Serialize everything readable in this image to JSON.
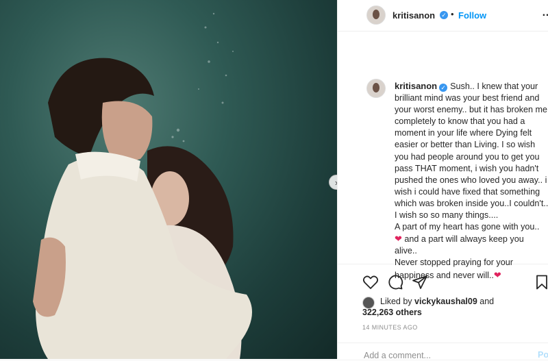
{
  "post": {
    "image_alt": "Underwater photo of a man in a white shirt embracing a woman with long dark hair",
    "next_glyph": "›"
  },
  "header": {
    "username": "kritisanon",
    "separator": "•",
    "follow_label": "Follow",
    "more_glyph": "…"
  },
  "caption": {
    "username": "kritisanon",
    "lines": [
      "Sush.. I knew that your brilliant mind was your best friend and your worst enemy.. but it has broken me completely to know that you had a moment in your life where Dying felt easier or better than Living. I so wish you had people around you to get you pass THAT moment, i wish you hadn't pushed the ones who loved you away.. i wish i could have fixed that something which was broken inside you..I couldn't..",
      "I wish so so many things....",
      "A part of my heart has gone with you..",
      "and a part will always keep you alive..",
      "Never stopped praying for your happiness and never will.."
    ],
    "heart_glyph": "❤"
  },
  "likes": {
    "liked_by_prefix": "Liked by",
    "liked_by_user": "vickykaushal09",
    "liked_by_suffix": "and",
    "count_text": "322,263 others"
  },
  "timestamp": "14 MINUTES AGO",
  "comment": {
    "placeholder": "Add a comment...",
    "post_label": "Post"
  },
  "colors": {
    "accent": "#0095f6",
    "heart": "#e0245e",
    "verified": "#3897f0"
  },
  "icons": [
    "like-heart-icon",
    "comment-icon",
    "share-icon",
    "save-bookmark-icon",
    "verified-badge-icon"
  ]
}
